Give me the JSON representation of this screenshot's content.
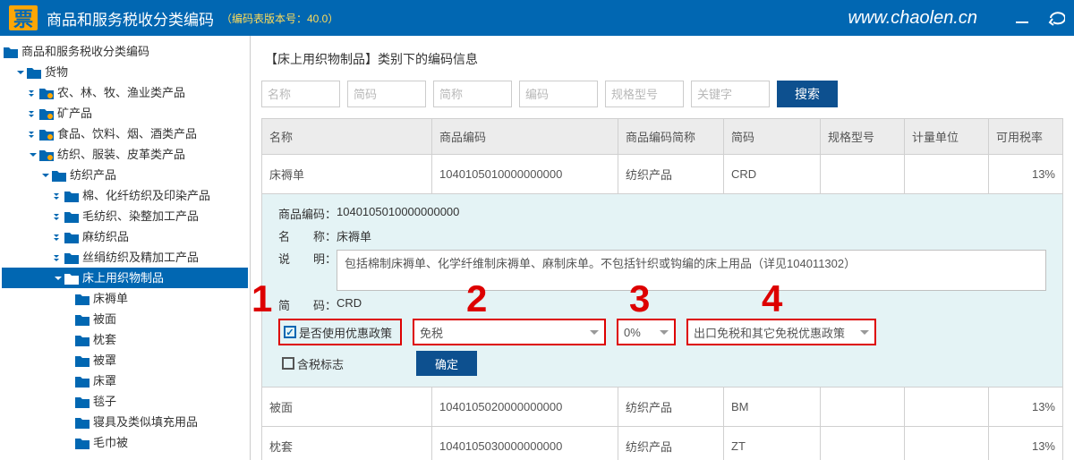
{
  "header": {
    "logo": "票",
    "title": "商品和服务税收分类编码",
    "version_label": "（编码表版本号：40.0）",
    "site": "www.chaolen.cn"
  },
  "tree": {
    "root": "商品和服务税收分类编码",
    "goods": "货物",
    "agri": "农、林、牧、渔业类产品",
    "mineral": "矿产品",
    "food": "食品、饮料、烟、酒类产品",
    "textile_root": "纺织、服装、皮革类产品",
    "textile": "纺织产品",
    "cotton": "棉、化纤纺织及印染产品",
    "wool": "毛纺织、染整加工产品",
    "hemp": "麻纺织品",
    "silk": "丝绢纺织及精加工产品",
    "bed": "床上用织物制品",
    "sheet": "床褥单",
    "quilt": "被面",
    "pillow": "枕套",
    "cover": "被罩",
    "bedcover": "床罩",
    "blanket": "毯子",
    "bedding_fill": "寝具及类似填充用品",
    "towelquilt": "毛巾被"
  },
  "content": {
    "title": "【床上用织物制品】类别下的编码信息",
    "filters": [
      "名称",
      "简码",
      "简称",
      "编码",
      "规格型号",
      "关键字"
    ],
    "search_btn": "搜索",
    "columns": [
      "名称",
      "商品编码",
      "商品编码简称",
      "简码",
      "规格型号",
      "计量单位",
      "可用税率"
    ],
    "rows": [
      {
        "name": "床褥单",
        "code": "1040105010000000000",
        "short": "纺织产品",
        "abbr": "CRD",
        "spec": "",
        "unit": "",
        "rate": "13%"
      },
      {
        "name": "被面",
        "code": "1040105020000000000",
        "short": "纺织产品",
        "abbr": "BM",
        "spec": "",
        "unit": "",
        "rate": "13%"
      },
      {
        "name": "枕套",
        "code": "1040105030000000000",
        "short": "纺织产品",
        "abbr": "ZT",
        "spec": "",
        "unit": "",
        "rate": "13%"
      }
    ]
  },
  "detail": {
    "code_label": "商品编码：",
    "code_val": "1040105010000000000",
    "name_label": "名　　称：",
    "name_val": "床褥单",
    "desc_label": "说　　明：",
    "desc_val": "包括棉制床褥单、化学纤维制床褥单、麻制床单。不包括针织或钩编的床上用品（详见104011302）",
    "abbr_label": "简　　码：",
    "abbr_val": "CRD",
    "opt_checkbox_label": "是否使用优惠政策",
    "opt_policy": "免税",
    "opt_rate": "0%",
    "opt_policy_detail": "出口免税和其它免税优惠政策",
    "tax_incl_label": "含税标志",
    "ok_btn": "确定",
    "anno": [
      "1",
      "2",
      "3",
      "4"
    ]
  }
}
